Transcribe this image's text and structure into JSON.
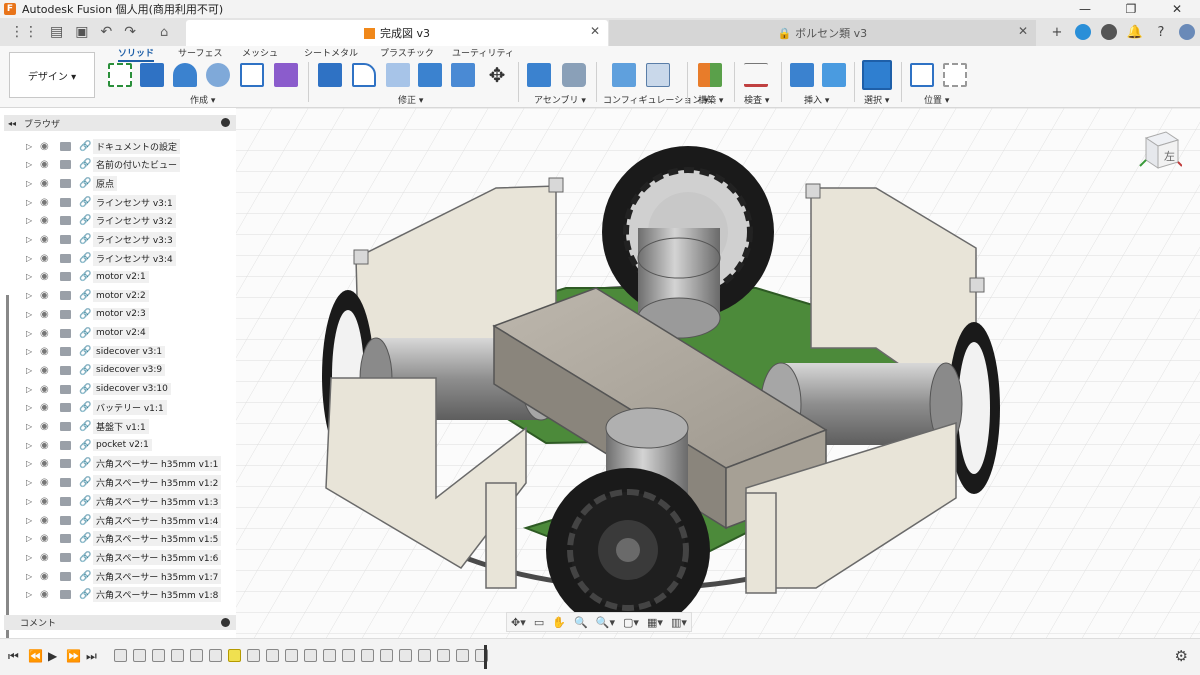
{
  "app": {
    "logo": "F",
    "title": "Autodesk Fusion 個人用(商用利用不可)"
  },
  "window_controls": [
    "—",
    "❐",
    "✕"
  ],
  "tabs": {
    "active": {
      "label": "完成図 v3"
    },
    "inactive": {
      "label": "🔒 ボルセン類 v3"
    },
    "close_glyph": "✕"
  },
  "toolbar": {
    "workspace_button": "デザイン ▾",
    "tabs": [
      "ソリッド",
      "サーフェス",
      "メッシュ",
      "シートメタル",
      "プラスチック",
      "ユーティリティ"
    ],
    "groups": [
      "作成 ▾",
      "修正 ▾",
      "アセンブリ ▾",
      "コンフィギュレーション ▾",
      "構築 ▾",
      "検査 ▾",
      "挿入 ▾",
      "選択 ▾",
      "位置 ▾"
    ]
  },
  "browser": {
    "title": "ブラウザ",
    "items": [
      {
        "label": "ドキュメントの設定"
      },
      {
        "label": "名前の付いたビュー"
      },
      {
        "label": "原点"
      },
      {
        "label": "ラインセンサ v3:1"
      },
      {
        "label": "ラインセンサ v3:2"
      },
      {
        "label": "ラインセンサ v3:3"
      },
      {
        "label": "ラインセンサ v3:4"
      },
      {
        "label": "motor v2:1"
      },
      {
        "label": "motor v2:2"
      },
      {
        "label": "motor v2:3"
      },
      {
        "label": "motor v2:4"
      },
      {
        "label": "sidecover v3:1"
      },
      {
        "label": "sidecover v3:9"
      },
      {
        "label": "sidecover v3:10"
      },
      {
        "label": "バッテリー v1:1"
      },
      {
        "label": "基盤下 v1:1"
      },
      {
        "label": "pocket v2:1"
      },
      {
        "label": "六角スペーサー h35mm v1:1"
      },
      {
        "label": "六角スペーサー h35mm v1:2"
      },
      {
        "label": "六角スペーサー h35mm v1:3"
      },
      {
        "label": "六角スペーサー h35mm v1:4"
      },
      {
        "label": "六角スペーサー h35mm v1:5"
      },
      {
        "label": "六角スペーサー h35mm v1:6"
      },
      {
        "label": "六角スペーサー h35mm v1:7"
      },
      {
        "label": "六角スペーサー h35mm v1:8"
      }
    ]
  },
  "comment": {
    "label": "コメント"
  },
  "viewcube": {
    "face_left": "左"
  },
  "colors": {
    "accent": "#1e5fa8",
    "wall": "#e8e4d8",
    "pcb": "#4c8a3a",
    "wheel": "#1a1a1a",
    "motor": "#9a9a9a"
  }
}
